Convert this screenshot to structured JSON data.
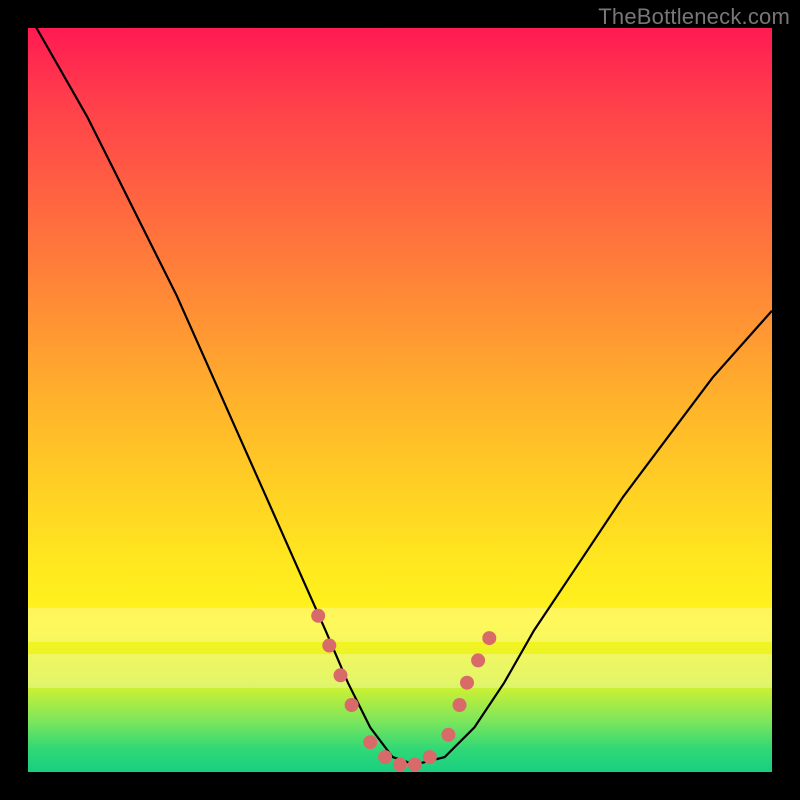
{
  "watermark": "TheBottleneck.com",
  "chart_data": {
    "type": "line",
    "title": "",
    "xlabel": "",
    "ylabel": "",
    "xlim": [
      0,
      100
    ],
    "ylim": [
      0,
      100
    ],
    "series": [
      {
        "name": "bottleneck-curve",
        "x": [
          0,
          4,
          8,
          12,
          16,
          20,
          24,
          28,
          32,
          36,
          40,
          43,
          46,
          49,
          52,
          56,
          60,
          64,
          68,
          74,
          80,
          86,
          92,
          100
        ],
        "y": [
          102,
          95,
          88,
          80,
          72,
          64,
          55,
          46,
          37,
          28,
          19,
          12,
          6,
          2,
          1,
          2,
          6,
          12,
          19,
          28,
          37,
          45,
          53,
          62
        ]
      }
    ],
    "markers": {
      "name": "highlight-points",
      "x": [
        39,
        40.5,
        42,
        43.5,
        46,
        48,
        50,
        52,
        54,
        56.5,
        58,
        59,
        60.5,
        62
      ],
      "y": [
        21,
        17,
        13,
        9,
        4,
        2,
        1,
        1,
        2,
        5,
        9,
        12,
        15,
        18
      ],
      "color": "#d96a6a",
      "radius": 7
    },
    "bands": [
      {
        "y0": 18,
        "y1": 22,
        "opacity": 0.28
      },
      {
        "y0": 12,
        "y1": 16,
        "opacity": 0.28
      }
    ],
    "gradient_stops": [
      {
        "pos": 0,
        "color": "#ff1a52"
      },
      {
        "pos": 25,
        "color": "#ff6a3f"
      },
      {
        "pos": 50,
        "color": "#ffb22b"
      },
      {
        "pos": 75,
        "color": "#ffec1c"
      },
      {
        "pos": 100,
        "color": "#18cf80"
      }
    ]
  }
}
